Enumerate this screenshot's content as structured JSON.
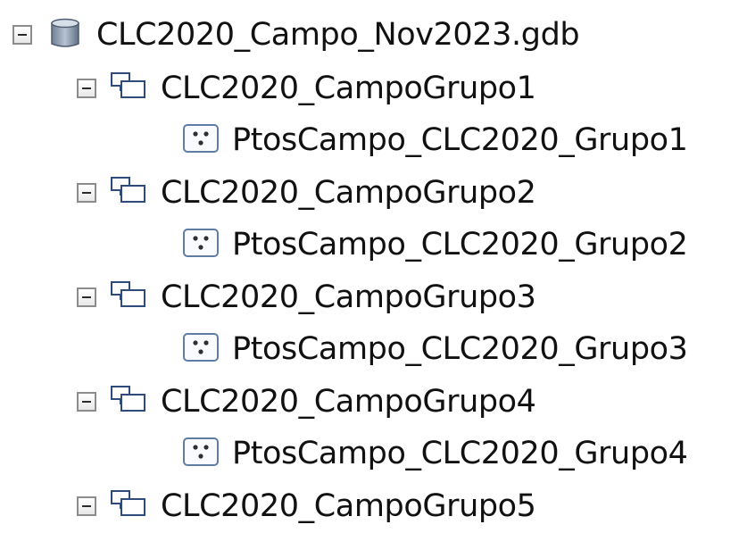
{
  "tree": {
    "root": {
      "label": "CLC2020_Campo_Nov2023.gdb",
      "icon": "database-icon",
      "expanded": true
    },
    "groups": [
      {
        "label": "CLC2020_CampoGrupo1",
        "icon": "feature-dataset-icon",
        "expanded": true,
        "children": [
          {
            "label": "PtosCampo_CLC2020_Grupo1",
            "icon": "point-feature-class-icon"
          }
        ]
      },
      {
        "label": "CLC2020_CampoGrupo2",
        "icon": "feature-dataset-icon",
        "expanded": true,
        "children": [
          {
            "label": "PtosCampo_CLC2020_Grupo2",
            "icon": "point-feature-class-icon"
          }
        ]
      },
      {
        "label": "CLC2020_CampoGrupo3",
        "icon": "feature-dataset-icon",
        "expanded": true,
        "children": [
          {
            "label": "PtosCampo_CLC2020_Grupo3",
            "icon": "point-feature-class-icon"
          }
        ]
      },
      {
        "label": "CLC2020_CampoGrupo4",
        "icon": "feature-dataset-icon",
        "expanded": true,
        "children": [
          {
            "label": "PtosCampo_CLC2020_Grupo4",
            "icon": "point-feature-class-icon"
          }
        ]
      },
      {
        "label": "CLC2020_CampoGrupo5",
        "icon": "feature-dataset-icon",
        "expanded": true,
        "children": []
      }
    ]
  }
}
